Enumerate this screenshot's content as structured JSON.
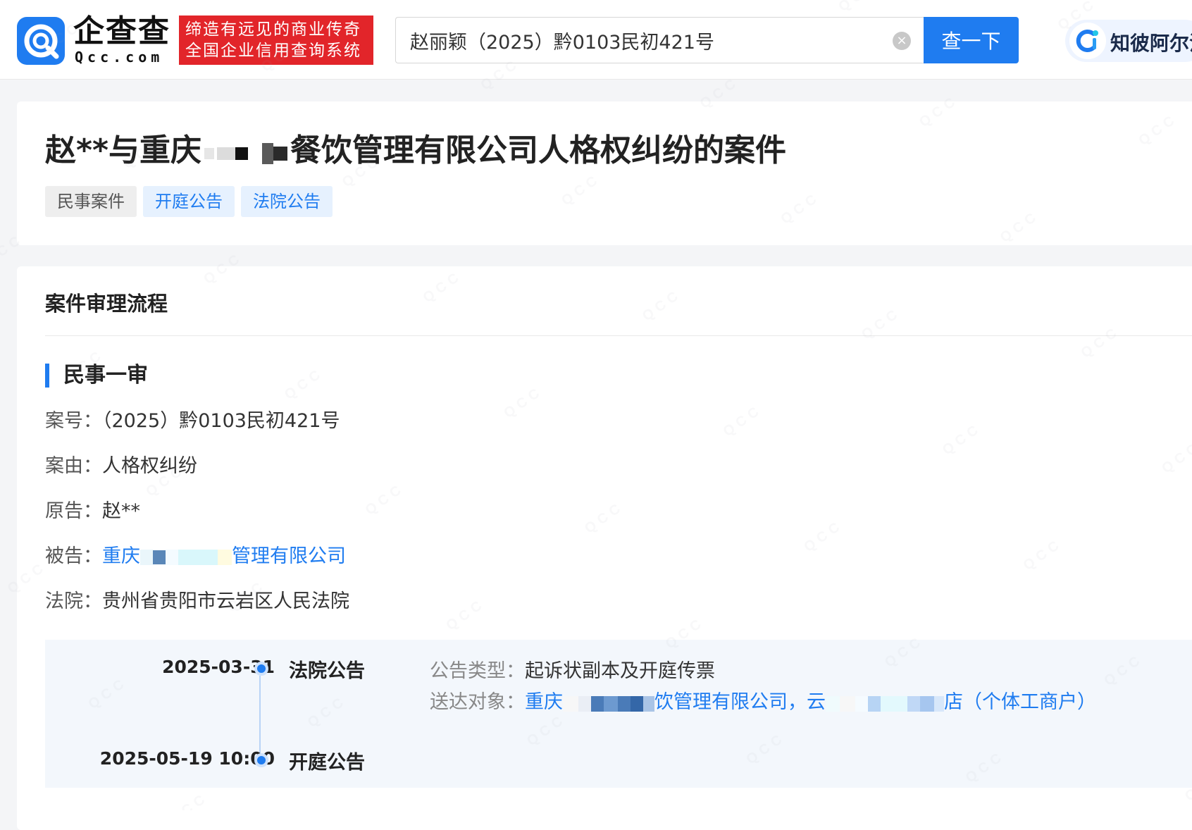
{
  "header": {
    "logo_cn": "企查查",
    "logo_en": "Qcc.com",
    "slogan_line1": "缔造有远见的商业传奇",
    "slogan_line2": "全国企业信用查询系统",
    "search_value": "赵丽颖（2025）黔0103民初421号",
    "search_button": "查一下",
    "assistant_label": "知彼阿尔法"
  },
  "case": {
    "title_prefix": "赵**与重庆",
    "title_suffix": "餐饮管理有限公司人格权纠纷的案件",
    "tags": [
      "民事案件",
      "开庭公告",
      "法院公告"
    ]
  },
  "process": {
    "section_title": "案件审理流程",
    "stage_title": "民事一审",
    "case_no_label": "案号：",
    "case_no_value": "（2025）黔0103民初421号",
    "cause_label": "案由：",
    "cause_value": "人格权纠纷",
    "plaintiff_label": "原告：",
    "plaintiff_value": "赵**",
    "defendant_label": "被告：",
    "defendant_prefix": "重庆",
    "defendant_suffix": "管理有限公司",
    "court_label": "法院：",
    "court_value": "贵州省贵阳市云岩区人民法院"
  },
  "timeline": [
    {
      "date": "2025-03-31",
      "type": "法院公告",
      "detail_type_label": "公告类型：",
      "detail_type_value": "起诉状副本及开庭传票",
      "recipients_label": "送达对象：",
      "recipient1_prefix": "重庆",
      "recipient1_suffix": "饮管理有限公司，",
      "recipient2_prefix": "云",
      "recipient2_suffix": "店（个体工商户）"
    },
    {
      "date": "2025-05-19 10:00",
      "type": "开庭公告"
    }
  ],
  "colors": {
    "accent": "#1f7cf0",
    "brand_red": "#e2252a"
  },
  "icons": [
    "qcc-logo-icon",
    "clear-icon",
    "alpha-assistant-icon"
  ]
}
